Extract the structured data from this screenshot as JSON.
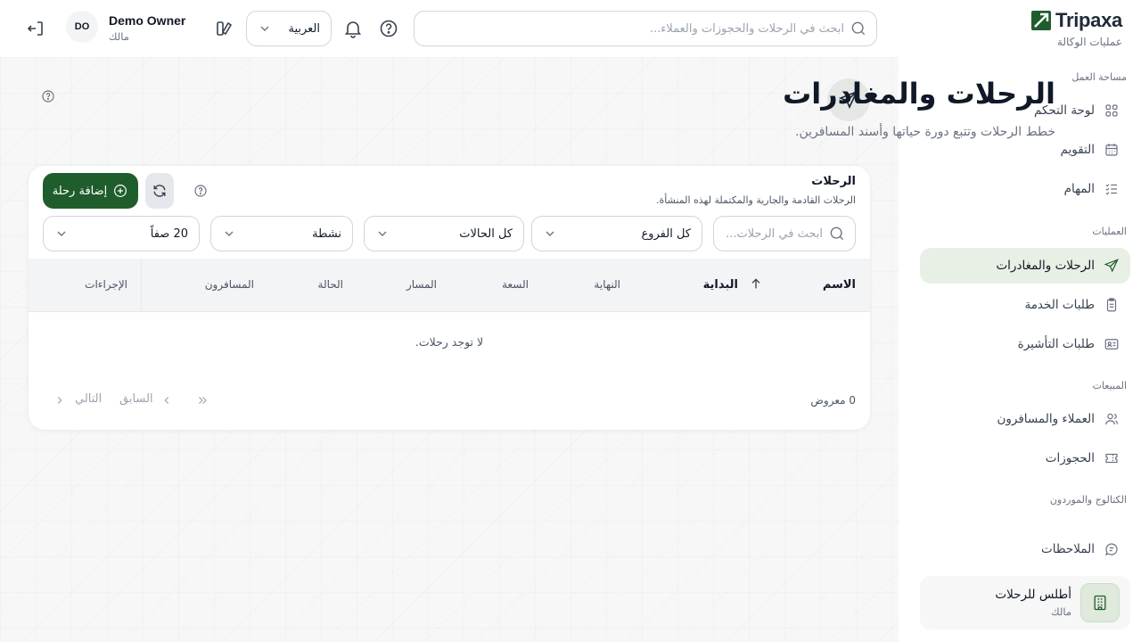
{
  "sidebar": {
    "brand": "Tripaxa",
    "brand_sub": "عمليات الوكالة",
    "sections": {
      "workspace": "مساحة العمل",
      "operations": "العمليات",
      "sales": "المبيعات",
      "catalog": "الكتالوج والموردون"
    },
    "items": {
      "dashboard": "لوحة التحكم",
      "calendar": "التقويم",
      "tasks": "المهام",
      "trips": "الرحلات والمغادرات",
      "service_requests": "طلبات الخدمة",
      "visa_requests": "طلبات التأشيرة",
      "customers": "العملاء والمسافرون",
      "bookings": "الحجوزات",
      "notes": "الملاحظات"
    },
    "org": {
      "name": "أطلس للرحلات",
      "role": "مالك"
    }
  },
  "header": {
    "search_placeholder": "ابحث في الرحلات والحجوزات والعملاء...",
    "language": "العربية",
    "user": {
      "initials": "DO",
      "name": "Demo Owner",
      "role": "مالك"
    }
  },
  "page": {
    "title": "الرحلات والمغادرات",
    "subtitle": "خطط الرحلات وتتبع دورة حياتها وأسند المسافرين."
  },
  "card": {
    "title": "الرحلات",
    "subtitle": "الرحلات القادمة والجارية والمكتملة لهذه المنشأة.",
    "add_button": "إضافة رحلة",
    "search_placeholder": "ابحث في الرحلات...",
    "filters": {
      "branch": "كل الفروع",
      "status": "كل الحالات",
      "active": "نشطة",
      "rows": "20 صفاً"
    },
    "columns": {
      "name": "الاسم",
      "start": "البداية",
      "end": "النهاية",
      "capacity": "السعة",
      "route": "المسار",
      "status": "الحالة",
      "travelers": "المسافرون",
      "actions": "الإجراءات"
    },
    "empty": "لا توجد رحلات.",
    "count": "0 معروض",
    "prev": "السابق",
    "next": "التالي"
  }
}
